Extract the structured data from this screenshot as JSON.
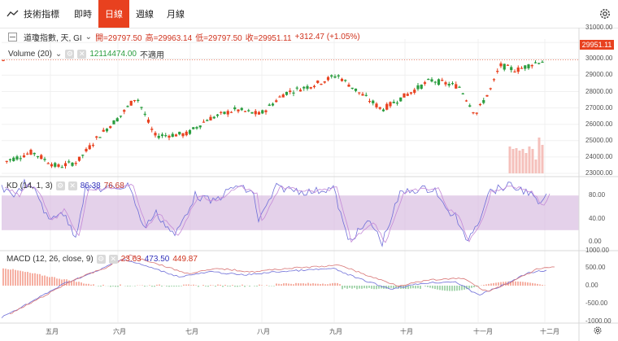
{
  "toolbar": {
    "indicators_label": "技術指標",
    "timeframes": [
      {
        "label": "即時",
        "active": false
      },
      {
        "label": "日線",
        "active": true
      },
      {
        "label": "週線",
        "active": false
      },
      {
        "label": "月線",
        "active": false
      }
    ]
  },
  "main_legend": {
    "symbol": "道瓊指數, 天, GI",
    "open": "開=29797.50",
    "high": "高=29963.14",
    "low": "低=29797.50",
    "close": "收=29951.11",
    "change": "+312.47 (+1.05%)"
  },
  "volume_legend": {
    "label": "Volume (20)",
    "value": "12114474.00",
    "na": "不適用"
  },
  "kd_legend": {
    "label": "KD (14, 1, 3)",
    "k": "86.38",
    "d": "76.68"
  },
  "macd_legend": {
    "label": "MACD (12, 26, close, 9)",
    "hist": "23.63",
    "macd": "473.50",
    "signal": "449.87"
  },
  "current_price_tag": "29951.11",
  "colors": {
    "up": "#e8411f",
    "down": "#2a9d3f",
    "accent": "#e8411f",
    "band": "#d5b8de",
    "kline": "#6e6ed8",
    "dline": "#c48ad8"
  },
  "price_axis": [
    "31000.00",
    "30000.00",
    "29000.00",
    "28000.00",
    "27000.00",
    "26000.00",
    "25000.00",
    "24000.00",
    "23000.00"
  ],
  "kd_axis": [
    "80.00",
    "40.00",
    "0.00"
  ],
  "macd_axis": [
    "1000.00",
    "500.00",
    "0.00",
    "-500.00",
    "-1000.00"
  ],
  "x_axis": [
    "五月",
    "六月",
    "七月",
    "八月",
    "九月",
    "十月",
    "十一月",
    "十二月"
  ]
}
